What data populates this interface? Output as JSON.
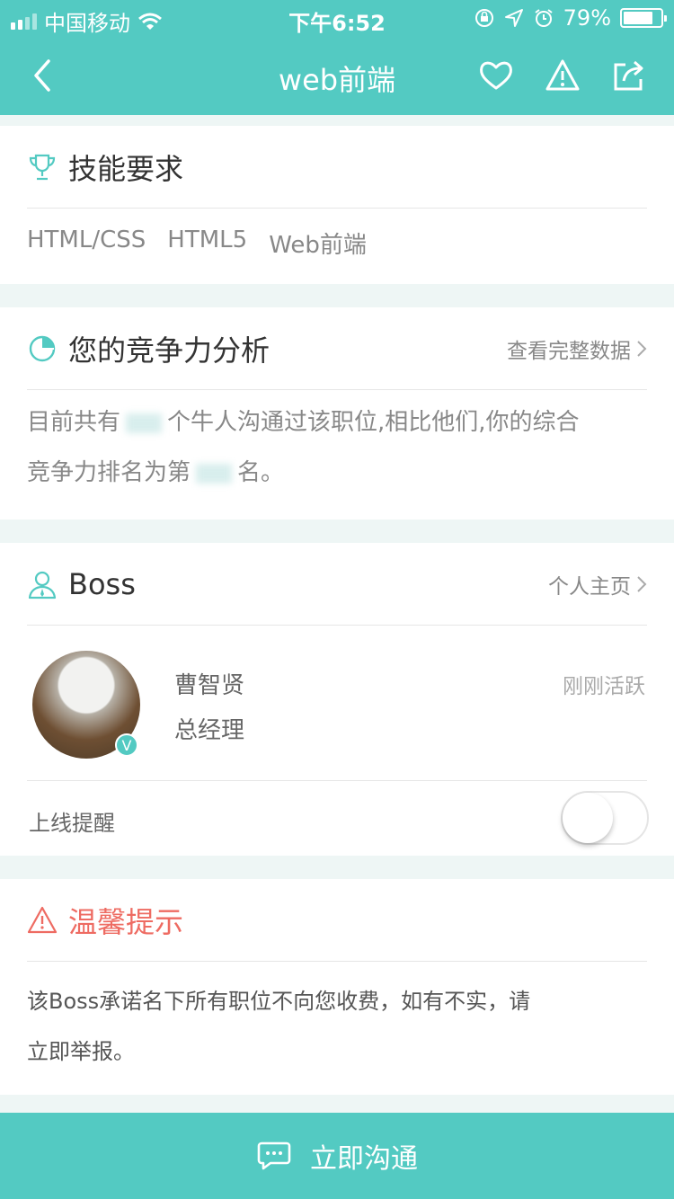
{
  "status_bar": {
    "carrier": "中国移动",
    "time": "下午6:52",
    "battery": "79%",
    "battery_level": 0.79
  },
  "nav": {
    "title": "web前端"
  },
  "skills": {
    "title": "技能要求",
    "tags": [
      "HTML/CSS",
      "HTML5",
      "Web前端"
    ]
  },
  "competition": {
    "title": "您的竞争力分析",
    "more": "查看完整数据",
    "text_1": "目前共有",
    "text_2": "个牛人沟通过该职位,相比他们,你的综合",
    "text_3": "竞争力排名为第",
    "text_4": "名。"
  },
  "boss": {
    "title": "Boss",
    "more": "个人主页",
    "name": "曹智贤",
    "role": "总经理",
    "active": "刚刚活跃",
    "verified_badge": "V",
    "remind_label": "上线提醒",
    "remind_on": false
  },
  "tips": {
    "title": "温馨提示",
    "text_1": "该Boss承诺名下所有职位不向您收费，如有不实，请",
    "text_2": "立即举报。"
  },
  "bottom": {
    "label": "立即沟通"
  },
  "colors": {
    "brand": "#53cac2",
    "warning": "#ee6b62"
  }
}
